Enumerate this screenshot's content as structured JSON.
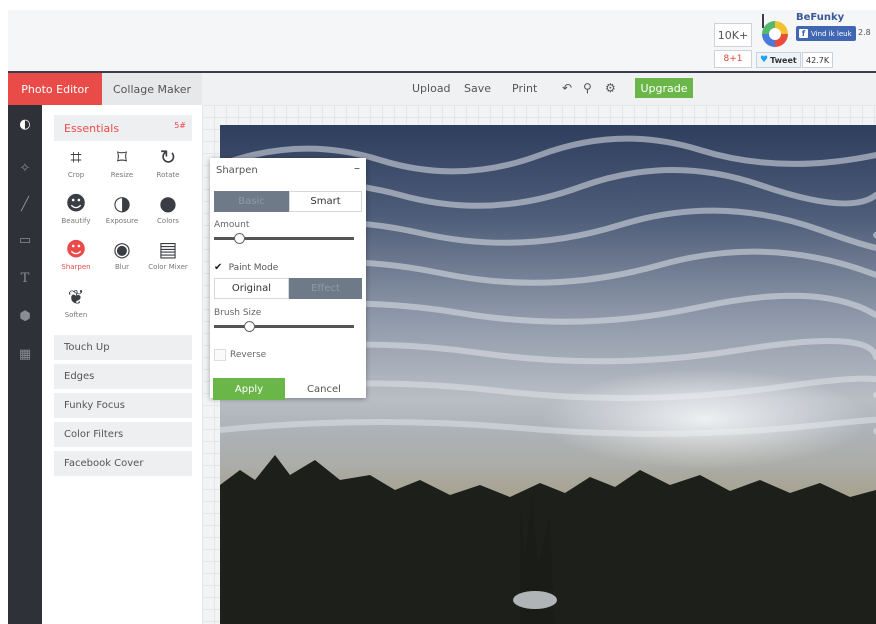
{
  "header": {
    "share_count": "10K+",
    "brand_name": "BeFunky",
    "fb_like_label": "Vind ik leuk",
    "fb_count": "2.8",
    "gplus_label": "8+1",
    "tweet_label": "Tweet",
    "tweet_count": "42.7K"
  },
  "tabs": {
    "photo_editor": "Photo Editor",
    "collage_maker": "Collage Maker"
  },
  "toolbar": {
    "upload": "Upload",
    "save": "Save",
    "print": "Print",
    "undo_icon": "↶",
    "zoom_icon": "⚲",
    "settings_icon": "⚙",
    "upgrade": "Upgrade"
  },
  "rail": {
    "icons": [
      "essentials-icon",
      "effects-icon",
      "brush-icon",
      "frames-icon",
      "text-icon",
      "graphics-icon",
      "textures-icon"
    ],
    "text_glyph": "T"
  },
  "essentials": {
    "title": "Essentials",
    "badge": "5#",
    "tools": [
      {
        "label": "Crop",
        "icon": "crop-icon"
      },
      {
        "label": "Resize",
        "icon": "resize-icon"
      },
      {
        "label": "Rotate",
        "icon": "rotate-icon"
      },
      {
        "label": "Beautify",
        "icon": "beautify-icon"
      },
      {
        "label": "Exposure",
        "icon": "exposure-icon"
      },
      {
        "label": "Colors",
        "icon": "colors-icon"
      },
      {
        "label": "Sharpen",
        "icon": "sharpen-icon"
      },
      {
        "label": "Blur",
        "icon": "blur-icon"
      },
      {
        "label": "Color Mixer",
        "icon": "color-mixer-icon"
      },
      {
        "label": "Soften",
        "icon": "soften-icon"
      }
    ],
    "sections": [
      "Touch Up",
      "Edges",
      "Funky Focus",
      "Color Filters",
      "Facebook Cover"
    ]
  },
  "sharpen": {
    "title": "Sharpen",
    "minimize": "–",
    "mode_basic": "Basic",
    "mode_smart": "Smart",
    "selected_mode": "Smart",
    "amount_label": "Amount",
    "amount_value": 0.18,
    "paint_mode_label": "Paint Mode",
    "paint_mode_checked": true,
    "original_label": "Original",
    "effect_label": "Effect",
    "brush_size_label": "Brush Size",
    "brush_size_value": 0.25,
    "reverse_label": "Reverse",
    "reverse_checked": false,
    "apply_label": "Apply",
    "cancel_label": "Cancel"
  },
  "colors": {
    "accent_red": "#e94b48",
    "upgrade_green": "#6bb648",
    "rail_dark": "#2f3138"
  }
}
